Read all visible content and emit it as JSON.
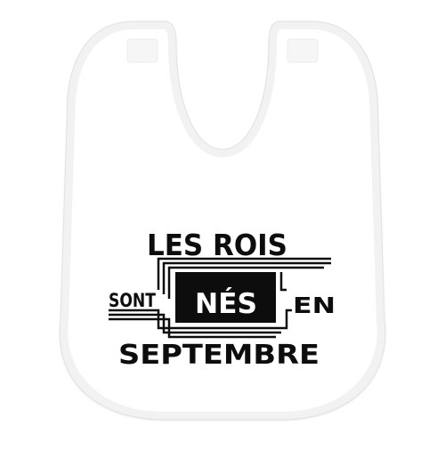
{
  "product": {
    "type": "baby bib",
    "body_color": "#ffffff",
    "trim_color": "#f0f0f0",
    "ink_color": "#0d0d0d"
  },
  "print": {
    "line1": "LES ROIS",
    "line2_left": "SONT",
    "line2_center": "NÉS",
    "line2_right": "EN",
    "line3": "SEPTEMBRE"
  }
}
